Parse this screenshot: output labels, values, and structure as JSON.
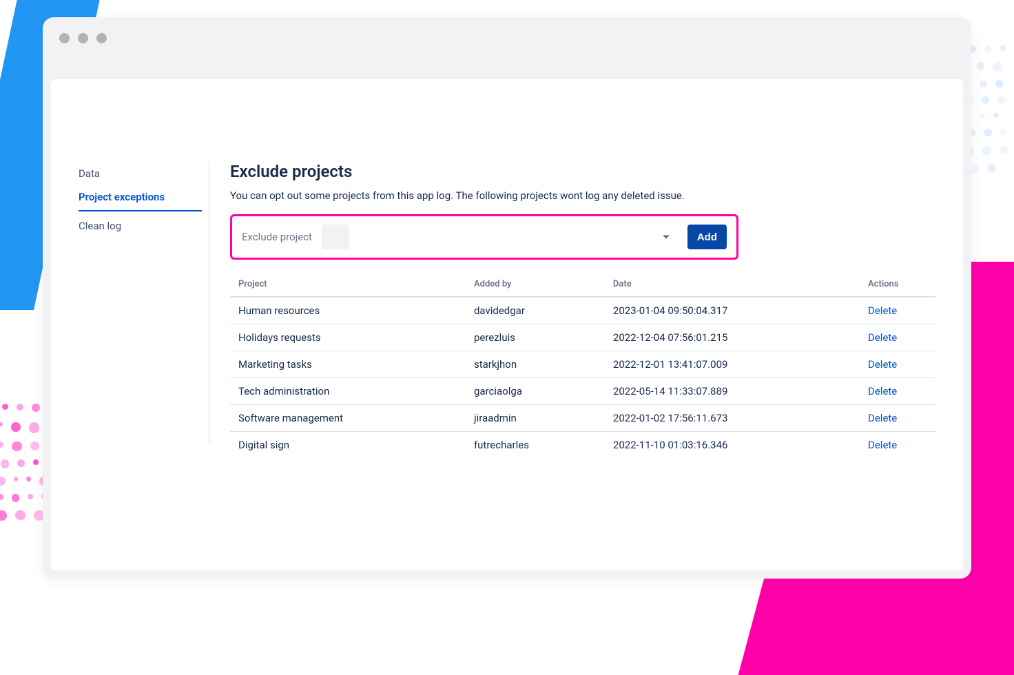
{
  "sidebar": {
    "items": [
      {
        "label": "Data"
      },
      {
        "label": "Project exceptions"
      },
      {
        "label": "Clean log"
      }
    ],
    "active_index": 1
  },
  "main": {
    "title": "Exclude projects",
    "description": "You can opt out some projects from this app log. The following projects wont log any deleted issue.",
    "form": {
      "label": "Exclude project",
      "add_button": "Add"
    },
    "table": {
      "headers": [
        "Project",
        "Added by",
        "Date",
        "Actions"
      ],
      "rows": [
        {
          "project": "Human resources",
          "added_by": "davidedgar",
          "date": "2023-01-04 09:50:04.317",
          "action": "Delete"
        },
        {
          "project": "Holidays requests",
          "added_by": "perezluis",
          "date": "2022-12-04 07:56:01.215",
          "action": "Delete"
        },
        {
          "project": "Marketing tasks",
          "added_by": "starkjhon",
          "date": "2022-12-01 13:41:07.009",
          "action": "Delete"
        },
        {
          "project": "Tech administration",
          "added_by": "garciaolga",
          "date": "2022-05-14 11:33:07.889",
          "action": "Delete"
        },
        {
          "project": "Software management",
          "added_by": "jiraadmin",
          "date": "2022-01-02 17:56:11.673",
          "action": "Delete"
        },
        {
          "project": "Digital sign",
          "added_by": "futrecharles",
          "date": "2022-11-10 01:03:16.346",
          "action": "Delete"
        }
      ]
    }
  }
}
